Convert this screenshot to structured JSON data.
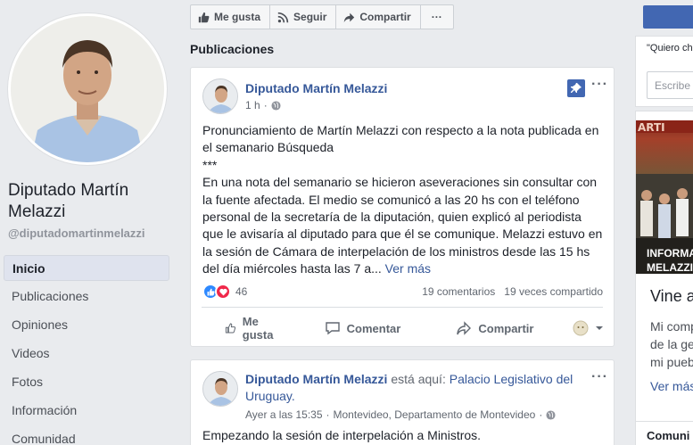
{
  "profile": {
    "name": "Diputado Martín Melazzi",
    "handle": "@diputadomartinmelazzi"
  },
  "nav": [
    {
      "label": "Inicio",
      "active": true
    },
    {
      "label": "Publicaciones"
    },
    {
      "label": "Opiniones"
    },
    {
      "label": "Videos"
    },
    {
      "label": "Fotos"
    },
    {
      "label": "Información"
    },
    {
      "label": "Comunidad"
    }
  ],
  "actionbar": {
    "like": "Me gusta",
    "follow": "Seguir",
    "share": "Compartir",
    "more": "···"
  },
  "section_title": "Publicaciones",
  "post1": {
    "author": "Diputado Martín Melazzi",
    "time": "1 h",
    "separator": "·",
    "text_intro": "Pronunciamiento de Martín Melazzi con respecto a la nota publicada en el semanario Búsqueda",
    "text_stars": "***",
    "text_body": "En una nota del semanario se hicieron aseveraciones sin consultar con la fuente afectada. El medio se comunicó a las 20 hs con el teléfono personal de la secretaría de la diputación, quien explicó al periodista que le avisaría al diputado para que él se comunique. Melazzi estuvo en la sesión de Cámara de interpelación de los ministros desde las 15 hs del día miércoles hasta las 7 a...",
    "see_more": "Ver más",
    "reaction_count": "46",
    "comments": "19 comentarios",
    "shares": "19 veces compartido",
    "action_like": "Me gusta",
    "action_comment": "Comentar",
    "action_share": "Compartir",
    "more": "···"
  },
  "post2": {
    "author": "Diputado Martín Melazzi",
    "is_at": "está aquí:",
    "location": "Palacio Legislativo del Uruguay.",
    "time": "Ayer a las 15:35",
    "separator": "·",
    "place": "Montevideo, Departamento de Montevideo",
    "text": "Empezando la sesión de interpelación a Ministros.",
    "more": "···"
  },
  "right": {
    "quote": "\"Quiero ch",
    "input_placeholder": "Escribe",
    "image_caption_1": "INFORMA",
    "image_caption_2": "MELAZZI",
    "headline": "Vine a",
    "body_1": "Mi comp",
    "body_2": "de la ge",
    "body_3": "mi puebl",
    "see_more": "Ver más",
    "community": "Comuni"
  }
}
